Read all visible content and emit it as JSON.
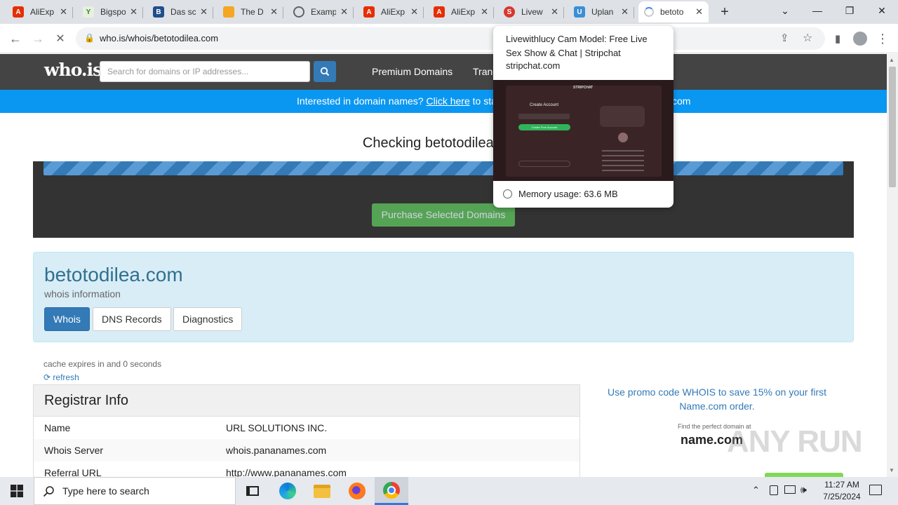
{
  "browser": {
    "tabs": [
      {
        "label": "AliExp",
        "icon": "aliexpress-icon",
        "color": "#e62e04"
      },
      {
        "label": "Bigspo",
        "icon": "yandex-icon",
        "color": "#d9e3d1"
      },
      {
        "label": "Das sc",
        "icon": "bs-icon",
        "color": "#1f4e8c"
      },
      {
        "label": "The D",
        "icon": "orange-icon",
        "color": "#f5a623"
      },
      {
        "label": "Examp",
        "icon": "globe-icon",
        "color": "#5f6368"
      },
      {
        "label": "AliExp",
        "icon": "aliexpress-icon",
        "color": "#e62e04"
      },
      {
        "label": "AliExp",
        "icon": "aliexpress-icon",
        "color": "#e62e04"
      },
      {
        "label": "Livew",
        "icon": "stripchat-icon",
        "color": "#d9362d"
      },
      {
        "label": "Uplan",
        "icon": "uplan-icon",
        "color": "#3a8fd6"
      },
      {
        "label": "betoto",
        "icon": "loading-icon",
        "color": "#9aa0a6"
      }
    ],
    "url": "who.is/whois/betotodilea.com"
  },
  "site": {
    "logo": "who.is",
    "search_placeholder": "Search for domains or IP addresses...",
    "nav": [
      "Premium Domains",
      "Tran"
    ],
    "banner_prefix": "Interested in domain names?",
    "banner_link": "Click here",
    "banner_suffix": "to stay up to date with dom",
    "banner_tail": "com",
    "checking": "Checking betotodilea.com",
    "purchase_label": "Purchase Selected Domains",
    "domain": "betotodilea.com",
    "subtitle": "whois information",
    "pills": [
      "Whois",
      "DNS Records",
      "Diagnostics"
    ],
    "cache": "cache expires in and 0 seconds",
    "refresh": "refresh",
    "registrar_title": "Registrar Info",
    "registrar_rows": [
      {
        "k": "Name",
        "v": "URL SOLUTIONS INC."
      },
      {
        "k": "Whois Server",
        "v": "whois.pananames.com"
      },
      {
        "k": "Referral URL",
        "v": "http://www.pananames.com"
      }
    ],
    "promo": "Use promo code WHOIS to save 15% on your first Name.com order.",
    "namecom_tag": "Find the perfect domain at",
    "namecom": "name.com",
    "watermark": "ANY RUN"
  },
  "tooltip": {
    "title": "Livewithlucy Cam Model: Free Live Sex Show & Chat | Stripchat",
    "domain": "stripchat.com",
    "memory": "Memory usage: 63.6 MB",
    "preview_heading": "Create Account",
    "preview_button": "Create Free Account"
  },
  "taskbar": {
    "search_text": "Type here to search",
    "time": "11:27 AM",
    "date": "7/25/2024"
  }
}
